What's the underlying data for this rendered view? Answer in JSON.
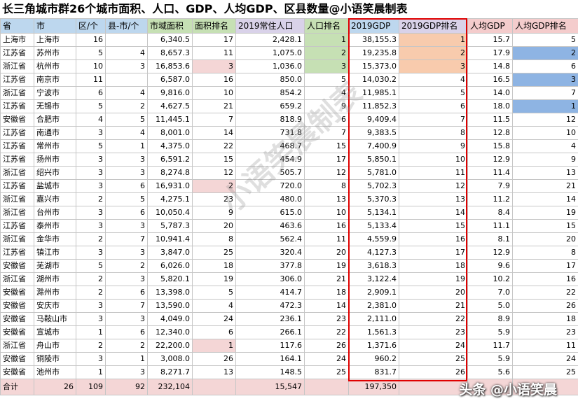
{
  "title": "长三角城市群26个城市面积、人口、GDP、人均GDP、区县数量@小语笑晨制表",
  "headers": [
    "省",
    "市",
    "区/个",
    "县-市/个",
    "市域面积",
    "面积排名",
    "2019常住人口",
    "人口排名",
    "2019GDP",
    "2019GDP排名",
    "人均GDP",
    "人均GDP排名"
  ],
  "rows": [
    [
      "上海市",
      "上海市",
      "16",
      "",
      "6,340.5",
      "17",
      "2,428.1",
      "1",
      "38,155.3",
      "1",
      "15.7",
      "5"
    ],
    [
      "江苏省",
      "苏州市",
      "5",
      "4",
      "8,657.3",
      "11",
      "1,075.0",
      "2",
      "19,235.8",
      "2",
      "17.9",
      "2"
    ],
    [
      "浙江省",
      "杭州市",
      "10",
      "3",
      "16,853.6",
      "3",
      "1,036.0",
      "3",
      "15,373.0",
      "3",
      "14.8",
      "6"
    ],
    [
      "江苏省",
      "南京市",
      "11",
      "",
      "6,587.0",
      "16",
      "850.0",
      "5",
      "14,030.2",
      "4",
      "16.5",
      "3"
    ],
    [
      "浙江省",
      "宁波市",
      "6",
      "4",
      "9,816.0",
      "10",
      "854.2",
      "4",
      "11,985.1",
      "5",
      "14.0",
      "7"
    ],
    [
      "江苏省",
      "无锡市",
      "5",
      "2",
      "4,627.5",
      "21",
      "659.2",
      "9",
      "11,852.3",
      "6",
      "18.0",
      "1"
    ],
    [
      "安徽省",
      "合肥市",
      "4",
      "5",
      "11,445.1",
      "7",
      "818.9",
      "6",
      "9,409.4",
      "7",
      "11.5",
      "12"
    ],
    [
      "江苏省",
      "南通市",
      "3",
      "4",
      "8,001.0",
      "14",
      "731.8",
      "7",
      "9,383.5",
      "8",
      "12.8",
      "10"
    ],
    [
      "江苏省",
      "常州市",
      "5",
      "1",
      "4,375.0",
      "22",
      "468.7",
      "15",
      "7,400.9",
      "9",
      "15.8",
      "4"
    ],
    [
      "江苏省",
      "扬州市",
      "3",
      "3",
      "6,591.2",
      "15",
      "454.9",
      "17",
      "5,850.1",
      "10",
      "12.9",
      "9"
    ],
    [
      "浙江省",
      "绍兴市",
      "3",
      "3",
      "8,274.8",
      "12",
      "505.7",
      "12",
      "5,781.0",
      "11",
      "11.4",
      "13"
    ],
    [
      "江苏省",
      "盐城市",
      "3",
      "6",
      "16,931.0",
      "2",
      "720.0",
      "8",
      "5,702.3",
      "12",
      "7.9",
      "21"
    ],
    [
      "浙江省",
      "嘉兴市",
      "2",
      "5",
      "4,275.1",
      "23",
      "480.0",
      "13",
      "5,370.3",
      "13",
      "11.2",
      "14"
    ],
    [
      "浙江省",
      "台州市",
      "3",
      "6",
      "10,050.4",
      "9",
      "615.0",
      "10",
      "5,134.1",
      "14",
      "8.4",
      "19"
    ],
    [
      "江苏省",
      "泰州市",
      "3",
      "3",
      "5,787.3",
      "20",
      "463.6",
      "16",
      "5,133.4",
      "15",
      "11.1",
      "15"
    ],
    [
      "浙江省",
      "金华市",
      "2",
      "7",
      "10,941.4",
      "8",
      "562.4",
      "11",
      "4,559.9",
      "16",
      "8.1",
      "20"
    ],
    [
      "江苏省",
      "镇江市",
      "3",
      "3",
      "3,847.0",
      "25",
      "320.4",
      "20",
      "4,127.3",
      "17",
      "12.9",
      "8"
    ],
    [
      "安徽省",
      "芜湖市",
      "5",
      "2",
      "6,026.0",
      "18",
      "377.8",
      "19",
      "3,618.3",
      "18",
      "9.6",
      "17"
    ],
    [
      "浙江省",
      "湖州市",
      "2",
      "3",
      "5,820.1",
      "19",
      "306.0",
      "21",
      "3,122.4",
      "19",
      "10.2",
      "16"
    ],
    [
      "安徽省",
      "滁州市",
      "2",
      "6",
      "13,398.0",
      "5",
      "414.7",
      "18",
      "2,909.1",
      "20",
      "7.0",
      "22"
    ],
    [
      "安徽省",
      "安庆市",
      "3",
      "7",
      "13,590.0",
      "4",
      "472.3",
      "14",
      "2,381.0",
      "21",
      "5.0",
      "26"
    ],
    [
      "安徽省",
      "马鞍山市",
      "3",
      "3",
      "4,049.0",
      "24",
      "236.1",
      "23",
      "2,111.0",
      "22",
      "8.9",
      "18"
    ],
    [
      "安徽省",
      "宣城市",
      "1",
      "6",
      "12,340.0",
      "6",
      "266.1",
      "22",
      "1,561.3",
      "23",
      "5.9",
      "23"
    ],
    [
      "浙江省",
      "舟山市",
      "2",
      "2",
      "22,200.0",
      "1",
      "117.6",
      "26",
      "1,371.6",
      "24",
      "11.7",
      "11"
    ],
    [
      "安徽省",
      "铜陵市",
      "3",
      "1",
      "3,008.0",
      "26",
      "164.1",
      "24",
      "960.2",
      "25",
      "5.9",
      "24"
    ],
    [
      "安徽省",
      "池州市",
      "1",
      "3",
      "8,271.7",
      "13",
      "148.5",
      "25",
      "831.7",
      "26",
      "5.6",
      "25"
    ]
  ],
  "total": [
    "合计",
    "26",
    "109",
    "92",
    "232,104",
    "",
    "15,547",
    "",
    "197,350",
    "",
    "",
    ""
  ],
  "watermark": "小语笑晨制表",
  "credit": "头条 @小语笑晨"
}
